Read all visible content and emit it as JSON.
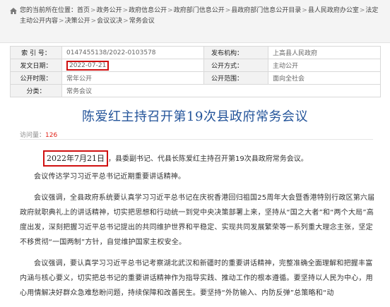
{
  "breadcrumb": {
    "prefix": "您的当前所在位置：",
    "items": [
      "首页",
      "政务公开",
      "政府信息公开",
      "政府部门信息公开",
      "县政府部门信息公开目录",
      "县人民政府办公室",
      "法定主动公开内容",
      "决策公开",
      "会议议决",
      "常务会议"
    ]
  },
  "meta": {
    "index_label": "索 引 号：",
    "index_value": "0147455138/2022-0103578",
    "publisher_label": "发布机构：",
    "publisher_value": "上高县人民政府",
    "date_label": "发文日期：",
    "date_value": "2022-07-21",
    "method_label": "公开方式：",
    "method_value": "主动公开",
    "time_label": "公开时限：",
    "time_value": "常年公开",
    "scope_label": "公开范围：",
    "scope_value": "面向全社会",
    "category_label": "分类：",
    "category_value": "常务会议"
  },
  "article": {
    "title": "陈爱红主持召开第19次县政府常务会议",
    "visits_label": "访问量：",
    "visits_value": "126",
    "date_text": "2022年7月21日",
    "p1_rest": "，县委副书记、代县长陈爱红主持召开第19次县政府常务会议。",
    "p2": "会议传达学习习近平总书记近期重要讲话精神。",
    "p3": "会议强调，全县政府系统要认真学习习近平总书记在庆祝香港回归祖国25周年大会暨香港特别行政区第六届政府就职典礼上的讲话精神，切实把思想和行动统一到党中央决策部署上来，坚持从“国之大者”和“两个大局”高度出发，深刻把握习近平总书记提出的共同维护世界和平稳定、实现共同发展繁荣等一系列重大理念主张，坚定不移贯彻“一国两制”方针，自觉维护国家主权安全。",
    "p4": "会议强调，要认真学习习近平总书记考察湖北武汉和新疆时的重要讲话精神，完整准确全面理解和把握丰富内涵与核心要义，切实把总书记的重要讲话精神作为指导实践、推动工作的根本遵循。要坚持以人民为中心，用心用情解决好群众急难愁盼问题，持续保障和改善民生。要坚持“外防输入、内防反弹”总策略和“动"
  }
}
